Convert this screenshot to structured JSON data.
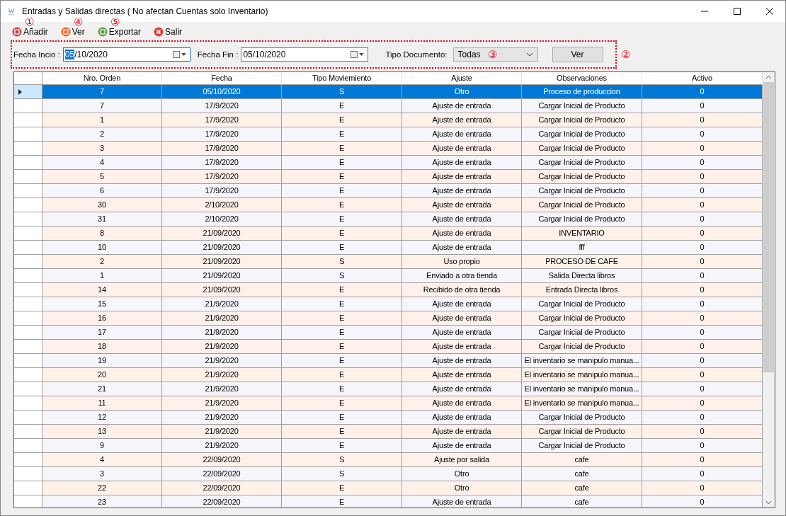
{
  "window": {
    "title": "Entradas y Salidas directas ( No afectan Cuentas solo Inventario)"
  },
  "toolbar": [
    {
      "label": "Añadir",
      "kind": "add",
      "annotation": "①"
    },
    {
      "label": "Ver",
      "kind": "view",
      "annotation": "④"
    },
    {
      "label": "Exportar",
      "kind": "export",
      "annotation": "⑤"
    },
    {
      "label": "Salir",
      "kind": "exit"
    }
  ],
  "filters": {
    "annotation": "②",
    "fecha_inicio": {
      "label": "Fecha Incio :",
      "selected_part": "05",
      "value": "/10/2020"
    },
    "fecha_fin": {
      "label": "Fecha Fin :",
      "value": "05/10/2020"
    },
    "tipo_documento": {
      "label": "Tipo Documento:",
      "value": "Todas",
      "annotation": "③"
    },
    "button": "Ver"
  },
  "table": {
    "columns": [
      "Nro. Orden",
      "Fecha",
      "Tipo Moviemiento",
      "Ajuste",
      "Observaciones",
      "Activo"
    ],
    "rows": [
      {
        "selected": true,
        "cells": [
          "7",
          "05/10/2020",
          "S",
          "Otro",
          "Proceso de produccion",
          "0"
        ]
      },
      {
        "selected": false,
        "cells": [
          "7",
          "17/9/2020",
          "E",
          "Ajuste de entrada",
          "Cargar Inicial de Producto",
          "0"
        ]
      },
      {
        "selected": false,
        "cells": [
          "1",
          "17/9/2020",
          "E",
          "Ajuste de entrada",
          "Cargar Inicial de Producto",
          "0"
        ]
      },
      {
        "selected": false,
        "cells": [
          "2",
          "17/9/2020",
          "E",
          "Ajuste de entrada",
          "Cargar Inicial de Producto",
          "0"
        ]
      },
      {
        "selected": false,
        "cells": [
          "3",
          "17/9/2020",
          "E",
          "Ajuste de entrada",
          "Cargar Inicial de Producto",
          "0"
        ]
      },
      {
        "selected": false,
        "cells": [
          "4",
          "17/9/2020",
          "E",
          "Ajuste de entrada",
          "Cargar Inicial de Producto",
          "0"
        ]
      },
      {
        "selected": false,
        "cells": [
          "5",
          "17/9/2020",
          "E",
          "Ajuste de entrada",
          "Cargar Inicial de Producto",
          "0"
        ]
      },
      {
        "selected": false,
        "cells": [
          "6",
          "17/9/2020",
          "E",
          "Ajuste de entrada",
          "Cargar Inicial de Producto",
          "0"
        ]
      },
      {
        "selected": false,
        "cells": [
          "30",
          "2/10/2020",
          "E",
          "Ajuste de entrada",
          "Cargar Inicial de Producto",
          "0"
        ]
      },
      {
        "selected": false,
        "cells": [
          "31",
          "2/10/2020",
          "E",
          "Ajuste de entrada",
          "Cargar Inicial de Producto",
          "0"
        ]
      },
      {
        "selected": false,
        "cells": [
          "8",
          "21/09/2020",
          "E",
          "Ajuste de entrada",
          "INVENTARIO",
          "0"
        ]
      },
      {
        "selected": false,
        "cells": [
          "10",
          "21/09/2020",
          "E",
          "Ajuste de entrada",
          "fff",
          "0"
        ]
      },
      {
        "selected": false,
        "cells": [
          "2",
          "21/09/2020",
          "S",
          "Uso propio",
          "PROCESO DE CAFE",
          "0"
        ]
      },
      {
        "selected": false,
        "cells": [
          "1",
          "21/09/2020",
          "S",
          "Enviado a otra tienda",
          "Salida Directa libros",
          "0"
        ]
      },
      {
        "selected": false,
        "cells": [
          "14",
          "21/09/2020",
          "E",
          "Recibido de otra tienda",
          "Entrada Directa libros",
          "0"
        ]
      },
      {
        "selected": false,
        "cells": [
          "15",
          "21/9/2020",
          "E",
          "Ajuste de entrada",
          "Cargar Inicial de Producto",
          "0"
        ]
      },
      {
        "selected": false,
        "cells": [
          "16",
          "21/9/2020",
          "E",
          "Ajuste de entrada",
          "Cargar Inicial de Producto",
          "0"
        ]
      },
      {
        "selected": false,
        "cells": [
          "17",
          "21/9/2020",
          "E",
          "Ajuste de entrada",
          "Cargar Inicial de Producto",
          "0"
        ]
      },
      {
        "selected": false,
        "cells": [
          "18",
          "21/9/2020",
          "E",
          "Ajuste de entrada",
          "Cargar Inicial de Producto",
          "0"
        ]
      },
      {
        "selected": false,
        "cells": [
          "19",
          "21/9/2020",
          "E",
          "Ajuste de entrada",
          "El inventario se manipulo manua...",
          "0"
        ]
      },
      {
        "selected": false,
        "cells": [
          "20",
          "21/9/2020",
          "E",
          "Ajuste de entrada",
          "El inventario se manipulo manua...",
          "0"
        ]
      },
      {
        "selected": false,
        "cells": [
          "21",
          "21/9/2020",
          "E",
          "Ajuste de entrada",
          "El inventario se manipulo manua...",
          "0"
        ]
      },
      {
        "selected": false,
        "cells": [
          "11",
          "21/9/2020",
          "E",
          "Ajuste de entrada",
          "El inventario se manipulo manua...",
          "0"
        ]
      },
      {
        "selected": false,
        "cells": [
          "12",
          "21/9/2020",
          "E",
          "Ajuste de entrada",
          "Cargar Inicial de Producto",
          "0"
        ]
      },
      {
        "selected": false,
        "cells": [
          "13",
          "21/9/2020",
          "E",
          "Ajuste de entrada",
          "Cargar Inicial de Producto",
          "0"
        ]
      },
      {
        "selected": false,
        "cells": [
          "9",
          "21/9/2020",
          "E",
          "Ajuste de entrada",
          "Cargar Inicial de Producto",
          "0"
        ]
      },
      {
        "selected": false,
        "cells": [
          "4",
          "22/09/2020",
          "S",
          "Ajuste por salida",
          "cafe",
          "0"
        ]
      },
      {
        "selected": false,
        "cells": [
          "3",
          "22/09/2020",
          "S",
          "Otro",
          "cafe",
          "0"
        ]
      },
      {
        "selected": false,
        "cells": [
          "22",
          "22/09/2020",
          "E",
          "Otro",
          "cafe",
          "0"
        ]
      },
      {
        "selected": false,
        "cells": [
          "23",
          "22/09/2020",
          "E",
          "Ajuste de entrada",
          "cafe",
          "0"
        ]
      }
    ]
  }
}
